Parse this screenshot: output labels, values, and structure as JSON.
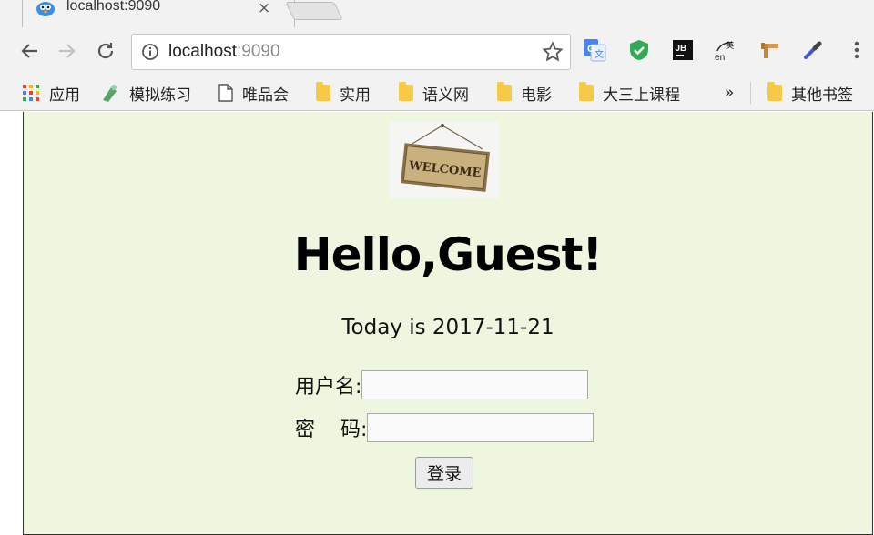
{
  "browser": {
    "tab": {
      "title": "localhost:9090",
      "close_glyph": "×"
    },
    "address": {
      "host": "localhost",
      "port": ":9090"
    },
    "accent": "#1a73e8"
  },
  "bookmarks": {
    "items": [
      {
        "label": "应用",
        "icon": "apps-grid-icon"
      },
      {
        "label": "模拟练习",
        "icon": "bookmark-figure-icon"
      },
      {
        "label": "唯品会",
        "icon": "page-icon"
      },
      {
        "label": "实用",
        "icon": "folder-icon"
      },
      {
        "label": "语义网",
        "icon": "folder-icon"
      },
      {
        "label": "电影",
        "icon": "folder-icon"
      },
      {
        "label": "大三上课程",
        "icon": "folder-icon"
      }
    ],
    "overflow": "»",
    "other": "其他书签"
  },
  "page": {
    "background": "#eff6e0",
    "sign_text": "WELCOME",
    "greeting": "Hello,Guest!",
    "today": "Today is 2017-11-21",
    "form": {
      "username_label": "用户名:",
      "password_label": "密    码:",
      "username_value": "",
      "password_value": "",
      "submit_label": "登录"
    }
  }
}
